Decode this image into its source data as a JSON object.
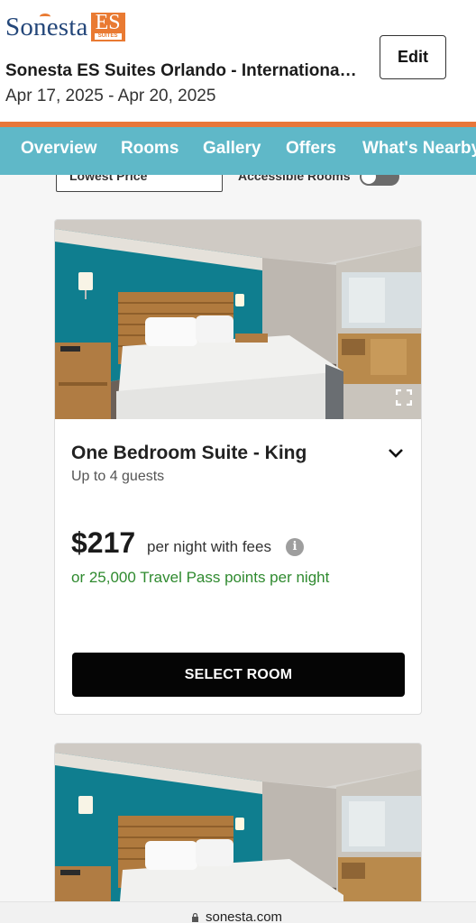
{
  "header": {
    "logo_word": "Sonesta",
    "logo_es": "ES",
    "logo_suites": "SUITES",
    "hotel_name": "Sonesta ES Suites Orlando - International Drive",
    "dates": "Apr 17, 2025 - Apr 20, 2025",
    "edit_label": "Edit"
  },
  "nav": {
    "items": [
      {
        "label": "Overview"
      },
      {
        "label": "Rooms"
      },
      {
        "label": "Gallery"
      },
      {
        "label": "Offers"
      },
      {
        "label": "What's Nearby"
      }
    ]
  },
  "filters": {
    "sort_value": "Lowest Price",
    "accessible_label": "Accessible Rooms",
    "accessible_on": false
  },
  "rooms": [
    {
      "name": "One Bedroom Suite - King",
      "guests": "Up to 4 guests",
      "price": "$217",
      "price_note": "per night with fees",
      "points": "or 25,000 Travel Pass points per night",
      "select_label": "SELECT ROOM"
    }
  ],
  "browser": {
    "url": "sonesta.com"
  },
  "colors": {
    "nav_bg": "#5fb8c8",
    "accent_orange": "#e8773a",
    "brand_blue": "#24477a",
    "points_green": "#2f8a2f",
    "button_black": "#050505"
  },
  "icons": [
    "expand-icon",
    "chevron-down-icon",
    "info-icon",
    "lock-icon"
  ]
}
